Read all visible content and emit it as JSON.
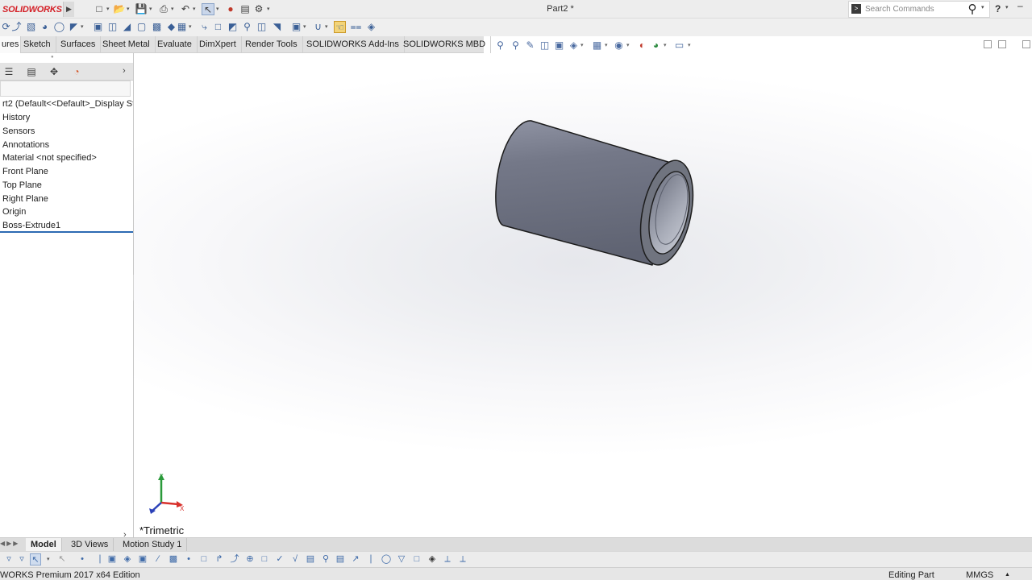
{
  "app": {
    "logo_text": "SOLIDWORKS",
    "document_title": "Part2 *"
  },
  "search": {
    "placeholder": "Search Commands"
  },
  "tabs": [
    "ures",
    "Sketch",
    "Surfaces",
    "Sheet Metal",
    "Evaluate",
    "DimXpert",
    "Render Tools",
    "SOLIDWORKS Add-Ins",
    "SOLIDWORKS MBD"
  ],
  "feature_tree": {
    "items": [
      "rt2  (Default<<Default>_Display Sta",
      "History",
      "Sensors",
      "Annotations",
      "Material <not specified>",
      "Front Plane",
      "Top Plane",
      "Right Plane",
      "Origin",
      "Boss-Extrude1"
    ]
  },
  "viewport": {
    "view_orientation": "*Trimetric",
    "triad_labels": {
      "x": "X",
      "y": "Y"
    }
  },
  "bottom_tabs": {
    "model": "Model",
    "views_3d": "3D Views",
    "motion_study": "Motion Study 1"
  },
  "status": {
    "edition": "WORKS Premium 2017 x64 Edition",
    "mode": "Editing Part",
    "units": "MMGS"
  },
  "colors": {
    "brand_red": "#d41f26",
    "selection_blue": "#2d6ab3",
    "part_gray": "#6e7180"
  }
}
